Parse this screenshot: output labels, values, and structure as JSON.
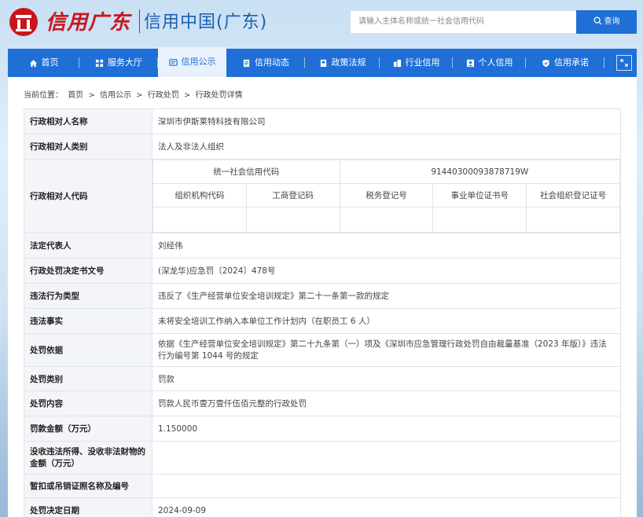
{
  "header": {
    "logo_script": "信用广东",
    "logo_text": "信用中国(广东)",
    "search_placeholder": "请输入主体名称或统一社会信用代码",
    "search_button": "查询"
  },
  "nav": {
    "items": [
      {
        "label": "首页",
        "icon": "home-icon"
      },
      {
        "label": "服务大厅",
        "icon": "grid-icon"
      },
      {
        "label": "信用公示",
        "icon": "publicity-icon",
        "active": true
      },
      {
        "label": "信用动态",
        "icon": "news-icon"
      },
      {
        "label": "政策法规",
        "icon": "book-icon"
      },
      {
        "label": "行业信用",
        "icon": "building-icon"
      },
      {
        "label": "个人信用",
        "icon": "person-icon"
      },
      {
        "label": "信用承诺",
        "icon": "shield-icon"
      }
    ]
  },
  "breadcrumb": {
    "prefix": "当前位置：",
    "items": [
      "首页",
      "信用公示",
      "行政处罚",
      "行政处罚详情"
    ],
    "separator": ">"
  },
  "detail": {
    "name_label": "行政相对人名称",
    "name_value": "深圳市伊斯莱特科技有限公司",
    "category_label": "行政相对人类别",
    "category_value": "法人及非法人组织",
    "code_label": "行政相对人代码",
    "uscc_label": "统一社会信用代码",
    "uscc_value": "91440300093878719W",
    "code_headers": [
      "组织机构代码",
      "工商登记码",
      "税务登记号",
      "事业单位证书号",
      "社会组织登记证号"
    ],
    "code_values": [
      "",
      "",
      "",
      "",
      ""
    ],
    "legal_rep_label": "法定代表人",
    "legal_rep_value": "刘经伟",
    "doc_no_label": "行政处罚决定书文号",
    "doc_no_value": "(深龙华)应急罚〔2024〕478号",
    "violation_type_label": "违法行为类型",
    "violation_type_value": "违反了《生产经营单位安全培训规定》第二十一条第一款的规定",
    "violation_fact_label": "违法事实",
    "violation_fact_value": "未将安全培训工作纳入本单位工作计划内（在职员工 6 人）",
    "basis_label": "处罚依据",
    "basis_value": "依据《生产经营单位安全培训规定》第二十九条第（一）项及《深圳市应急管理行政处罚自由裁量基准（2023 年版）》违法行为编号第 1044 号的规定",
    "penalty_type_label": "处罚类别",
    "penalty_type_value": "罚款",
    "penalty_content_label": "处罚内容",
    "penalty_content_value": "罚款人民币壹万壹仟伍佰元整的行政处罚",
    "amount_label": "罚款金额（万元）",
    "amount_value": "1.150000",
    "confiscation_label": "没收违法所得、没收非法财物的金额（万元）",
    "confiscation_value": "",
    "license_label": "暂扣或吊销证照名称及编号",
    "license_value": "",
    "decision_date_label": "处罚决定日期",
    "decision_date_value": "2024-09-09"
  },
  "colors": {
    "brand_blue": "#1f6fd6",
    "logo_red": "#c8161d",
    "label_bg": "#f3f5f8"
  }
}
